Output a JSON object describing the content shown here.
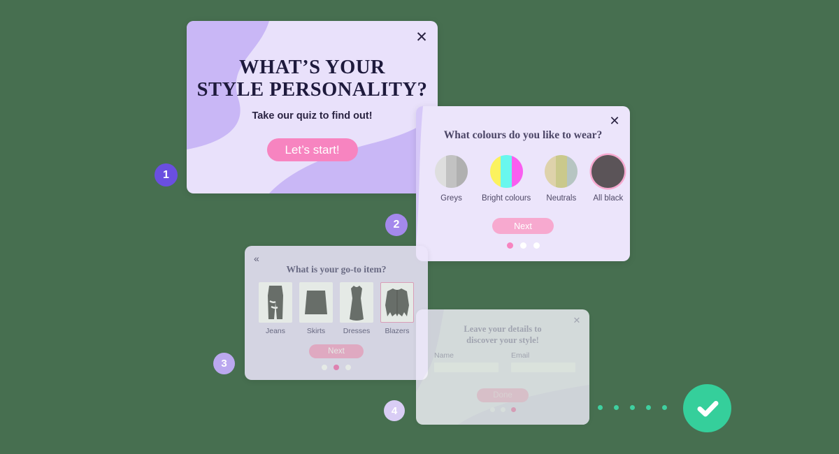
{
  "page": {
    "background_color": "#476f50"
  },
  "cards": {
    "card1": {
      "title_line1": "WHAT’S YOUR",
      "title_line2": "STYLE PERSONALITY?",
      "subtitle": "Take our quiz to find out!",
      "cta_label": "Let’s start!",
      "close_glyph": "✕",
      "accent_color": "#f784c0",
      "background_color": "#e9e1fb"
    },
    "card2": {
      "question": "What colours do you like to wear?",
      "close_glyph": "✕",
      "next_label": "Next",
      "background_color": "#ece5fb",
      "swatches": [
        {
          "label": "Greys",
          "colors": [
            "#dedede",
            "#c2c2c2",
            "#b0b0b0"
          ],
          "selected": false
        },
        {
          "label": "Bright colours",
          "colors": [
            "#fbf25e",
            "#69f7ee",
            "#f95ef0"
          ],
          "selected": false
        },
        {
          "label": "Neutrals",
          "colors": [
            "#ded2ab",
            "#cac98c",
            "#b6c5c2"
          ],
          "selected": false
        },
        {
          "label": "All black",
          "colors": [
            "#5b5458",
            "#5b5458",
            "#5b5458"
          ],
          "selected": true
        }
      ],
      "dots": [
        {
          "active": true
        },
        {
          "active": false
        },
        {
          "active": false
        }
      ]
    },
    "card3": {
      "back_glyph": "«",
      "question": "What is your go-to item?",
      "next_label": "Next",
      "background_color": "#ece5fb",
      "items": [
        {
          "label": "Jeans",
          "icon": "jeans-icon",
          "selected": false
        },
        {
          "label": "Skirts",
          "icon": "skirt-icon",
          "selected": false
        },
        {
          "label": "Dresses",
          "icon": "dress-icon",
          "selected": false
        },
        {
          "label": "Blazers",
          "icon": "blazer-icon",
          "selected": true
        }
      ],
      "dots": [
        {
          "active": false
        },
        {
          "active": true
        },
        {
          "active": false
        }
      ]
    },
    "card4": {
      "heading_line1": "Leave your details to",
      "heading_line2": "discover your style!",
      "close_glyph": "✕",
      "done_label": "Done",
      "background_color": "#f7f5fd",
      "fields": [
        {
          "label": "Name",
          "value": "",
          "placeholder": ""
        },
        {
          "label": "Email",
          "value": "",
          "placeholder": ""
        }
      ],
      "dots": [
        {
          "active": false
        },
        {
          "active": false
        },
        {
          "active": true
        }
      ]
    }
  },
  "badges": [
    {
      "number": "1",
      "color": "#6a4fe0"
    },
    {
      "number": "2",
      "color": "#a489ec"
    },
    {
      "number": "3",
      "color": "#bba8ef"
    },
    {
      "number": "4",
      "color": "#d9cdf5"
    }
  ],
  "progress": {
    "dot_count": 5,
    "dot_color": "#3fd0a0",
    "check_color": "#35cf9b",
    "check_glyph": "✓"
  }
}
